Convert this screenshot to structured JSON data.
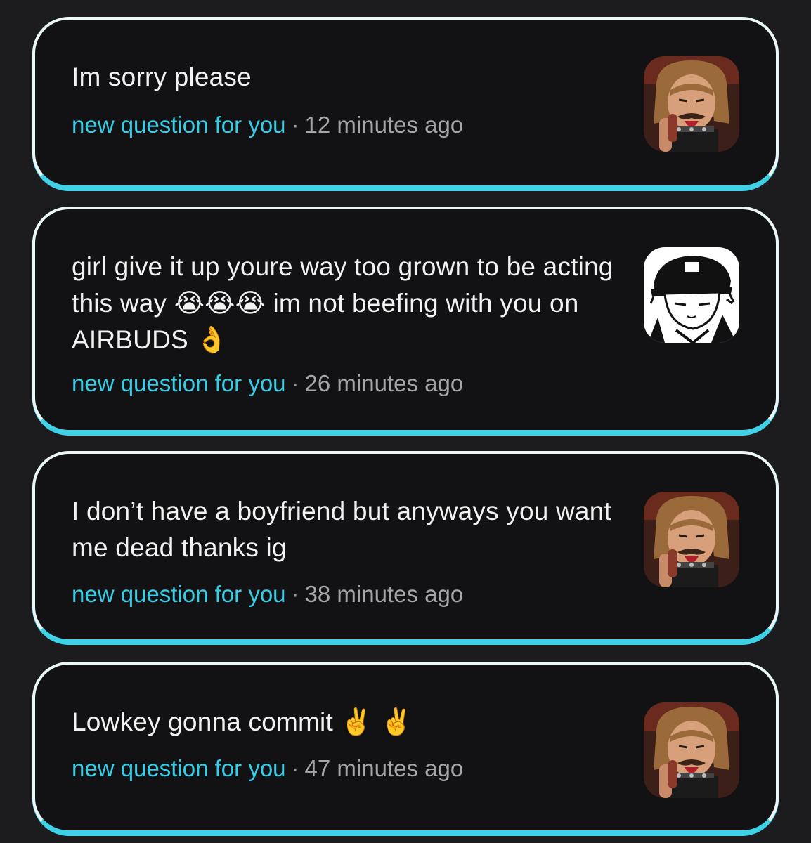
{
  "notifications": [
    {
      "message": "Im sorry please",
      "tag": "new question for you",
      "separator": "·",
      "time": "12 minutes ago",
      "avatar_icon": "cartoon-man-avatar-icon"
    },
    {
      "message": "girl give it up youre way too grown to be acting this way 😭😭😭 im not beefing with you on AIRBUDS 👌",
      "tag": "new question for you",
      "separator": "·",
      "time": "26 minutes ago",
      "avatar_icon": "manga-character-avatar-icon"
    },
    {
      "message": "I don’t have a boyfriend but anyways you want me dead thanks ig",
      "tag": "new question for you",
      "separator": "·",
      "time": "38 minutes ago",
      "avatar_icon": "cartoon-man-avatar-icon"
    },
    {
      "message": "Lowkey gonna commit ✌️ ✌️",
      "tag": "new question for you",
      "separator": "·",
      "time": "47 minutes ago",
      "avatar_icon": "cartoon-man-avatar-icon"
    }
  ],
  "colors": {
    "background": "#1c1c1e",
    "card": "#121214",
    "accent": "#3fd2e6",
    "tag": "#37cde6",
    "meta": "#a6a6aa"
  }
}
